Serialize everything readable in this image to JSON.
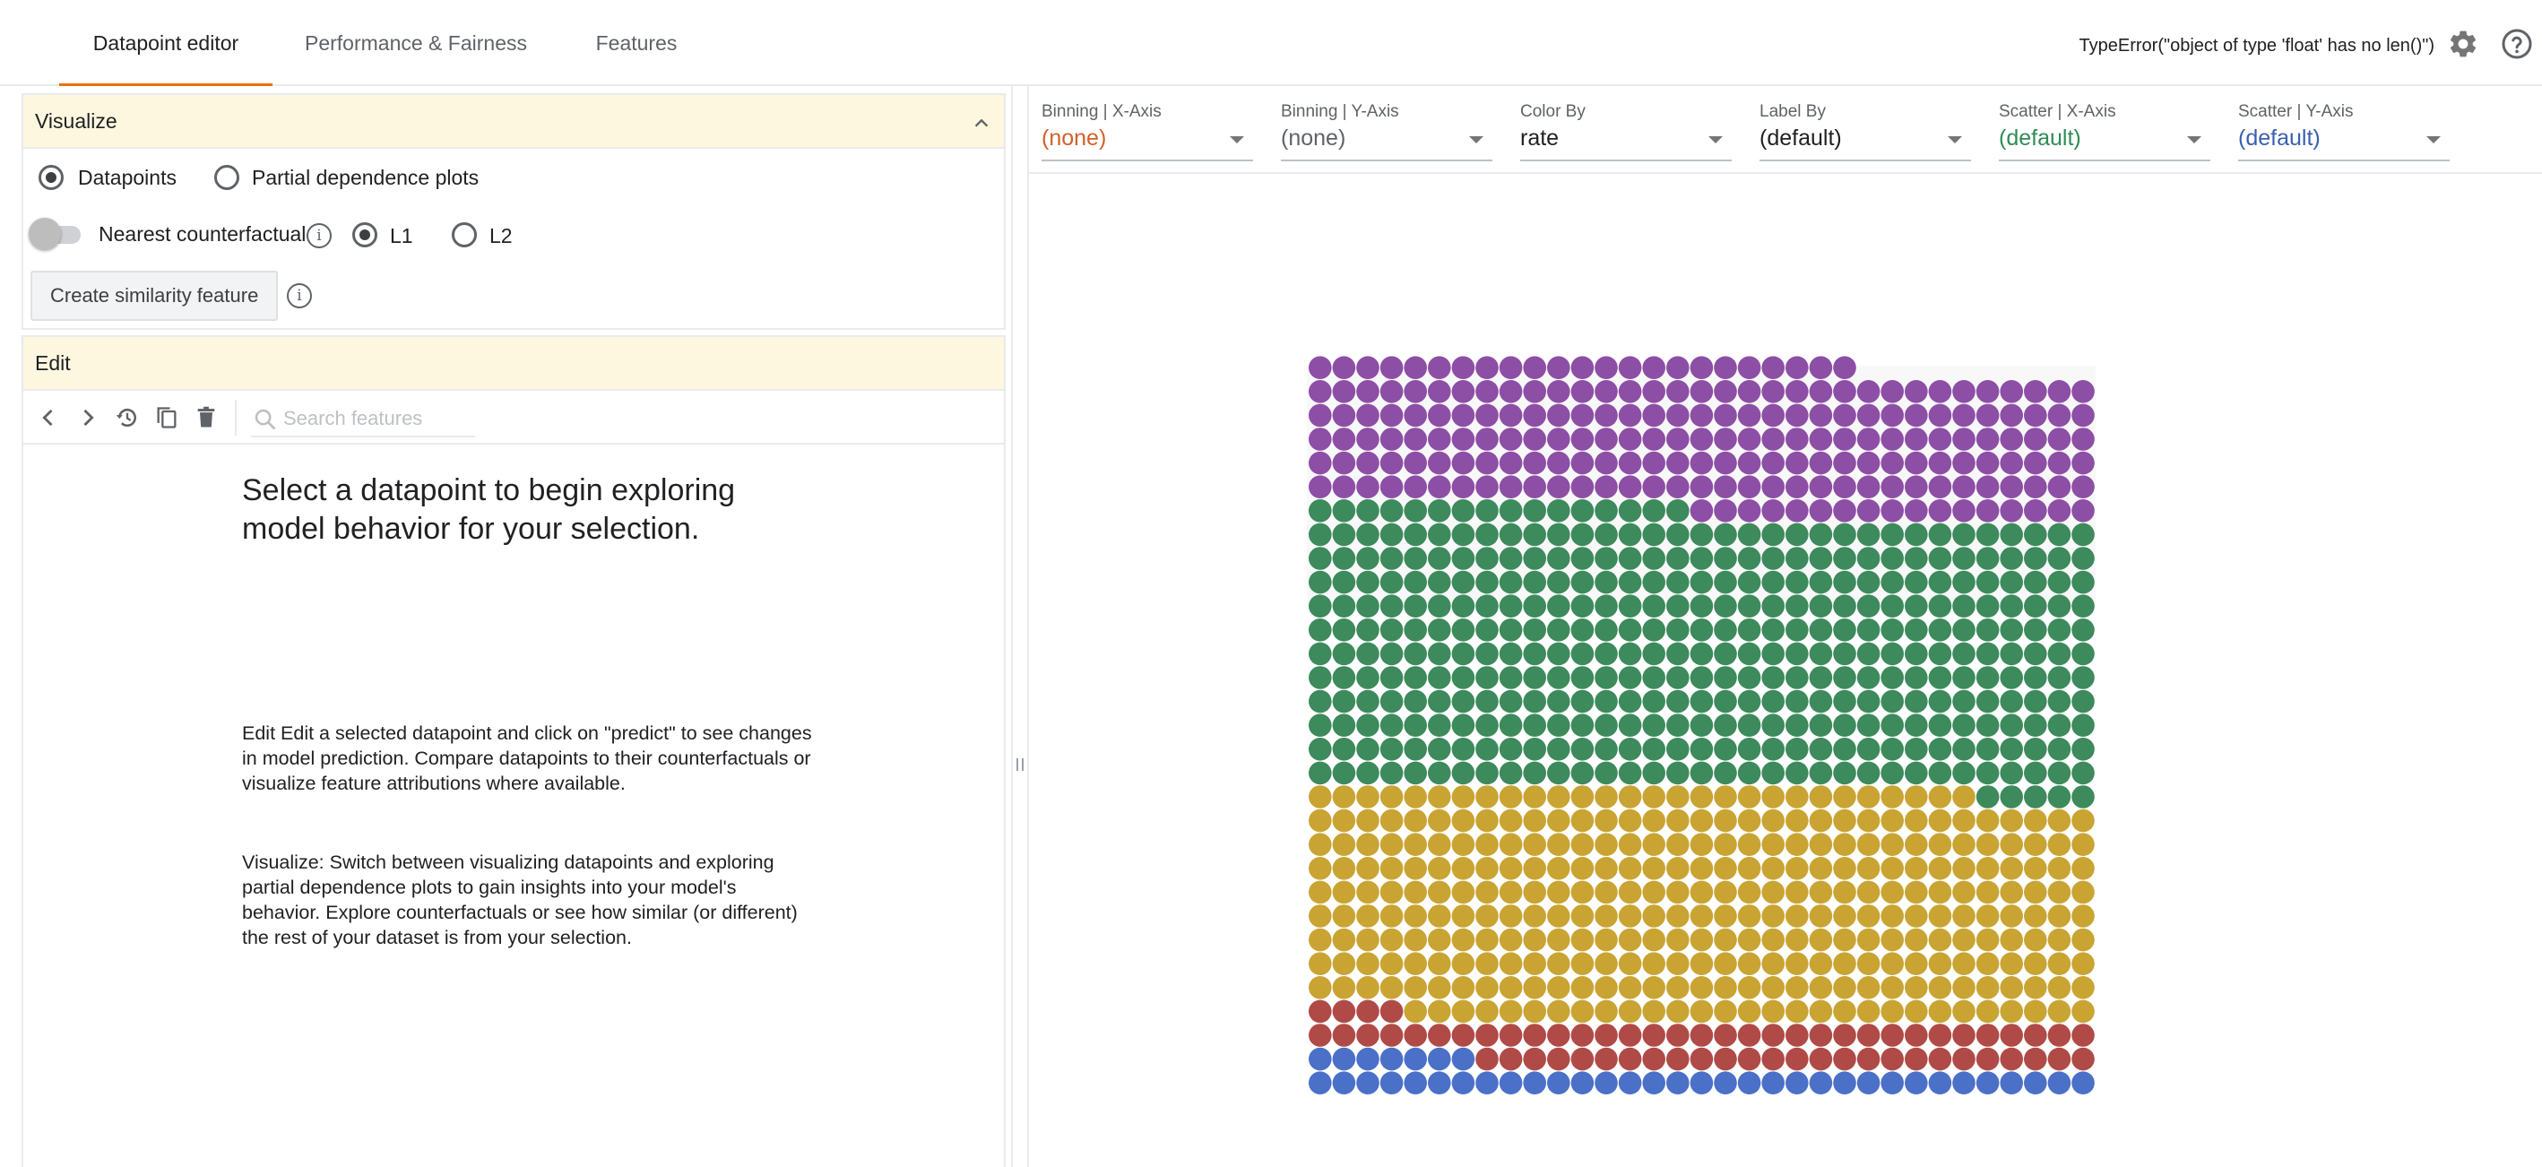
{
  "header": {
    "tabs": [
      {
        "label": "Datapoint editor",
        "active": true
      },
      {
        "label": "Performance & Fairness",
        "active": false
      },
      {
        "label": "Features",
        "active": false
      }
    ],
    "error_message": "TypeError(\"object of type 'float' has no len()\")",
    "icons": [
      "gear-icon",
      "help-icon"
    ],
    "accent_color": "#e8710a"
  },
  "visualize": {
    "title": "Visualize",
    "options": [
      {
        "label": "Datapoints",
        "selected": true
      },
      {
        "label": "Partial dependence plots",
        "selected": false
      }
    ],
    "nearest_counterfactual": {
      "label": "Nearest counterfactual",
      "enabled": false,
      "distance_options": [
        {
          "label": "L1",
          "selected": true
        },
        {
          "label": "L2",
          "selected": false
        }
      ]
    },
    "similarity_button": "Create similarity feature"
  },
  "edit": {
    "title": "Edit",
    "search_placeholder": "Search features",
    "toolbar_icons": [
      "chevron-left-icon",
      "chevron-right-icon",
      "history-icon",
      "copy-icon",
      "delete-icon"
    ],
    "message_title": "Select a datapoint to begin exploring model behavior for your selection.",
    "message_edit": "Edit Edit a selected datapoint and click on \"predict\" to see changes in model prediction. Compare datapoints to their counterfactuals or visualize feature attributions where available.",
    "message_visualize": "Visualize: Switch between visualizing datapoints and exploring partial dependence plots to gain insights into your model's behavior. Explore counterfactuals or see how similar (or different) the rest of your dataset is from your selection."
  },
  "controls": [
    {
      "label": "Binning | X-Axis",
      "value": "(none)",
      "color": "#d2602a"
    },
    {
      "label": "Binning | Y-Axis",
      "value": "(none)",
      "color": "#5f6368"
    },
    {
      "label": "Color By",
      "value": "rate",
      "color": "#202124"
    },
    {
      "label": "Label By",
      "value": "(default)",
      "color": "#202124"
    },
    {
      "label": "Scatter | X-Axis",
      "value": "(default)",
      "color": "#2e8b57"
    },
    {
      "label": "Scatter | Y-Axis",
      "value": "(default)",
      "color": "#3a5fb0"
    }
  ],
  "chart_data": {
    "type": "scatter",
    "layout": "facets-dive-grid",
    "columns": 33,
    "rows": 31,
    "total_points": 1013,
    "color_by": "rate",
    "groups": [
      {
        "color": "#4a70c8",
        "count": 40
      },
      {
        "color": "#b04a47",
        "count": 63
      },
      {
        "color": "#c9a433",
        "count": 321
      },
      {
        "color": "#3d8a5c",
        "count": 384
      },
      {
        "color": "#8d4ea5",
        "count": 205
      }
    ]
  }
}
